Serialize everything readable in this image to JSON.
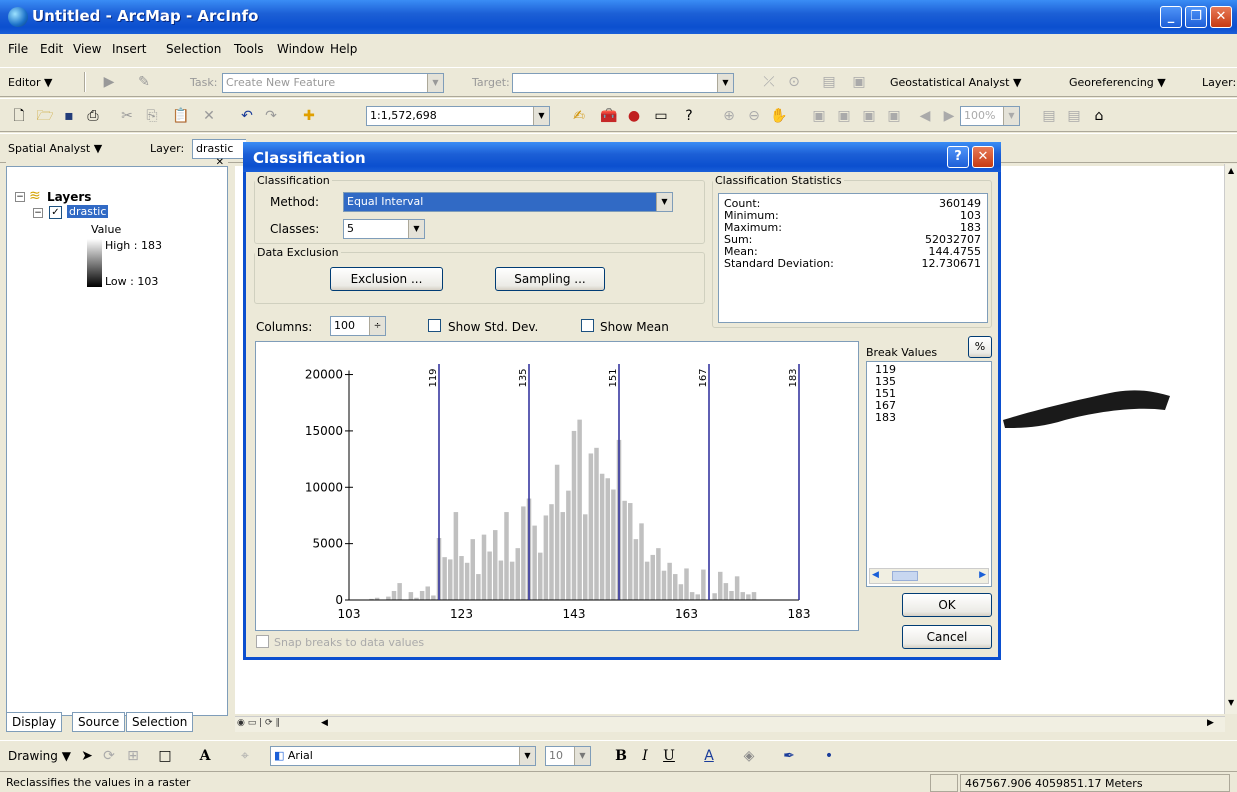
{
  "window": {
    "title": "Untitled - ArcMap - ArcInfo"
  },
  "menu": [
    "File",
    "Edit",
    "View",
    "Insert",
    "Selection",
    "Tools",
    "Window",
    "Help"
  ],
  "editor_toolbar": {
    "editor": "Editor ▼",
    "task_label": "Task:",
    "task_value": "Create New Feature",
    "target_label": "Target:",
    "geostat": "Geostatistical Analyst ▼",
    "georef": "Georeferencing ▼",
    "layer_cut": "Layer:"
  },
  "standard_toolbar": {
    "scale": "1:1,572,698",
    "zoom": "100%"
  },
  "spatial_toolbar": {
    "spatial_analyst": "Spatial Analyst ▼",
    "layer_label": "Layer:",
    "layer_value": "drastic"
  },
  "toc": {
    "root": "Layers",
    "layer": "drastic",
    "value_label": "Value",
    "high": "High : 183",
    "low": "Low : 103",
    "tabs": [
      "Display",
      "Source",
      "Selection"
    ]
  },
  "dialog": {
    "title": "Classification",
    "classification_group": "Classification",
    "method_label": "Method:",
    "method_value": "Equal Interval",
    "classes_label": "Classes:",
    "classes_value": "5",
    "exclusion_group": "Data Exclusion",
    "exclusion_btn": "Exclusion ...",
    "sampling_btn": "Sampling ...",
    "stats_group": "Classification Statistics",
    "stats": [
      {
        "label": "Count:",
        "value": "360149"
      },
      {
        "label": "Minimum:",
        "value": "103"
      },
      {
        "label": "Maximum:",
        "value": "183"
      },
      {
        "label": "Sum:",
        "value": "52032707"
      },
      {
        "label": "Mean:",
        "value": "144.4755"
      },
      {
        "label": "Standard Deviation:",
        "value": "12.730671"
      }
    ],
    "columns_label": "Columns:",
    "columns_value": "100",
    "show_std": "Show Std. Dev.",
    "show_mean": "Show Mean",
    "break_values_label": "Break Values",
    "percent_btn": "%",
    "break_values": [
      "119",
      "135",
      "151",
      "167",
      "183"
    ],
    "snap": "Snap breaks to data values",
    "ok": "OK",
    "cancel": "Cancel"
  },
  "chart_data": {
    "type": "bar",
    "xlim": [
      103,
      183
    ],
    "ylim": [
      0,
      22000
    ],
    "x_ticks": [
      "103",
      "123",
      "143",
      "163",
      "183"
    ],
    "y_ticks": [
      "0",
      "5000",
      "10000",
      "15000",
      "20000"
    ],
    "breaks": [
      119,
      135,
      151,
      167,
      183
    ],
    "bins_x": [
      103,
      104,
      105,
      106,
      107,
      108,
      109,
      110,
      111,
      112,
      113,
      114,
      115,
      116,
      117,
      118,
      119,
      120,
      121,
      122,
      123,
      124,
      125,
      126,
      127,
      128,
      129,
      130,
      131,
      132,
      133,
      134,
      135,
      136,
      137,
      138,
      139,
      140,
      141,
      142,
      143,
      144,
      145,
      146,
      147,
      148,
      149,
      150,
      151,
      152,
      153,
      154,
      155,
      156,
      157,
      158,
      159,
      160,
      161,
      162,
      163,
      164,
      165,
      166,
      167,
      168,
      169,
      170,
      171,
      172,
      173,
      174,
      175,
      176,
      177,
      178,
      179,
      180,
      181,
      182,
      183
    ],
    "values": [
      0,
      0,
      0,
      0,
      100,
      200,
      0,
      300,
      800,
      1500,
      0,
      700,
      200,
      800,
      1200,
      400,
      5500,
      3800,
      3600,
      7800,
      3900,
      3300,
      5400,
      2300,
      5800,
      4300,
      6200,
      3500,
      7800,
      3400,
      4600,
      8300,
      9000,
      6600,
      4200,
      7500,
      8500,
      12000,
      7800,
      9700,
      15000,
      16000,
      7600,
      13000,
      13500,
      11200,
      10800,
      9800,
      14200,
      8800,
      8600,
      5400,
      6800,
      3400,
      4000,
      4600,
      2600,
      3300,
      2300,
      1400,
      2800,
      700,
      500,
      2700,
      0,
      600,
      2500,
      1500,
      800,
      2100,
      700,
      500,
      700,
      0,
      0,
      0,
      0,
      0,
      0,
      0,
      0
    ]
  },
  "drawing_toolbar": {
    "drawing": "Drawing ▼",
    "font": "Arial",
    "size": "10"
  },
  "status": {
    "left": "Reclassifies the values in a raster",
    "right": "467567.906  4059851.17 Meters"
  }
}
